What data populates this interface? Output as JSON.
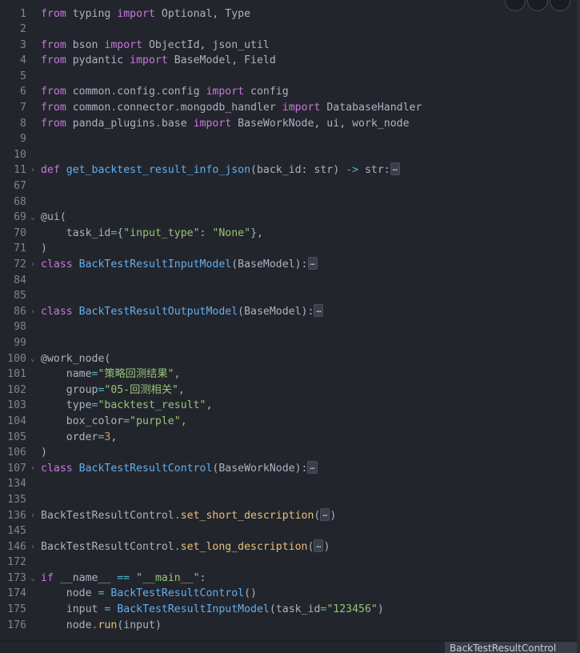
{
  "statusbar": {
    "breadcrumb": "BackTestResultControl"
  },
  "fold_placeholder": "…",
  "lines": [
    {
      "n": "1",
      "fold": "",
      "tokens": [
        [
          "kw",
          "from"
        ],
        [
          "pl",
          " typing "
        ],
        [
          "kw",
          "import"
        ],
        [
          "pl",
          " Optional, Type"
        ]
      ]
    },
    {
      "n": "2",
      "fold": "",
      "tokens": []
    },
    {
      "n": "3",
      "fold": "",
      "tokens": [
        [
          "kw",
          "from"
        ],
        [
          "pl",
          " bson "
        ],
        [
          "kw",
          "import"
        ],
        [
          "pl",
          " ObjectId, json_util"
        ]
      ]
    },
    {
      "n": "4",
      "fold": "",
      "tokens": [
        [
          "kw",
          "from"
        ],
        [
          "pl",
          " pydantic "
        ],
        [
          "kw",
          "import"
        ],
        [
          "pl",
          " BaseModel, Field"
        ]
      ]
    },
    {
      "n": "5",
      "fold": "",
      "tokens": []
    },
    {
      "n": "6",
      "fold": "",
      "tokens": [
        [
          "kw",
          "from"
        ],
        [
          "pl",
          " common"
        ],
        [
          "op",
          "."
        ],
        [
          "pl",
          "config"
        ],
        [
          "op",
          "."
        ],
        [
          "pl",
          "config "
        ],
        [
          "kw",
          "import"
        ],
        [
          "pl",
          " config"
        ]
      ]
    },
    {
      "n": "7",
      "fold": "",
      "tokens": [
        [
          "kw",
          "from"
        ],
        [
          "pl",
          " common"
        ],
        [
          "op",
          "."
        ],
        [
          "pl",
          "connector"
        ],
        [
          "op",
          "."
        ],
        [
          "pl",
          "mongodb_handler "
        ],
        [
          "kw",
          "import"
        ],
        [
          "pl",
          " DatabaseHandler"
        ]
      ]
    },
    {
      "n": "8",
      "fold": "",
      "tokens": [
        [
          "kw",
          "from"
        ],
        [
          "pl",
          " panda_plugins"
        ],
        [
          "op",
          "."
        ],
        [
          "pl",
          "base "
        ],
        [
          "kw",
          "import"
        ],
        [
          "pl",
          " BaseWorkNode, ui, work_node"
        ]
      ]
    },
    {
      "n": "9",
      "fold": "",
      "tokens": []
    },
    {
      "n": "10",
      "fold": "",
      "tokens": []
    },
    {
      "n": "11",
      "fold": ">",
      "tokens": [
        [
          "kw",
          "def"
        ],
        [
          "pl",
          " "
        ],
        [
          "fn",
          "get_backtest_result_info_json"
        ],
        [
          "pl",
          "(back_id: str) "
        ],
        [
          "op",
          "->"
        ],
        [
          "pl",
          " str:"
        ],
        [
          "ell",
          ""
        ]
      ]
    },
    {
      "n": "67",
      "fold": "",
      "tokens": []
    },
    {
      "n": "68",
      "fold": "",
      "tokens": []
    },
    {
      "n": "69",
      "fold": "v",
      "tokens": [
        [
          "dec",
          "@ui("
        ]
      ]
    },
    {
      "n": "70",
      "fold": "",
      "tokens": [
        [
          "pl",
          "    task_id"
        ],
        [
          "op",
          "="
        ],
        [
          "pl",
          "{"
        ],
        [
          "str",
          "\"input_type\""
        ],
        [
          "pl",
          ": "
        ],
        [
          "str",
          "\"None\""
        ],
        [
          "pl",
          "},"
        ]
      ]
    },
    {
      "n": "71",
      "fold": "",
      "tokens": [
        [
          "pl",
          ")"
        ]
      ]
    },
    {
      "n": "72",
      "fold": ">",
      "tokens": [
        [
          "kw",
          "class"
        ],
        [
          "pl",
          " "
        ],
        [
          "cls",
          "BackTestResultInputModel"
        ],
        [
          "pl",
          "(BaseModel):"
        ],
        [
          "ell",
          ""
        ]
      ]
    },
    {
      "n": "84",
      "fold": "",
      "tokens": []
    },
    {
      "n": "85",
      "fold": "",
      "tokens": []
    },
    {
      "n": "86",
      "fold": ">",
      "tokens": [
        [
          "kw",
          "class"
        ],
        [
          "pl",
          " "
        ],
        [
          "cls",
          "BackTestResultOutputModel"
        ],
        [
          "pl",
          "(BaseModel):"
        ],
        [
          "ell",
          ""
        ]
      ]
    },
    {
      "n": "98",
      "fold": "",
      "tokens": []
    },
    {
      "n": "99",
      "fold": "",
      "tokens": []
    },
    {
      "n": "100",
      "fold": "v",
      "tokens": [
        [
          "dec",
          "@work_node("
        ]
      ]
    },
    {
      "n": "101",
      "fold": "",
      "tokens": [
        [
          "pl",
          "    name"
        ],
        [
          "op",
          "="
        ],
        [
          "str",
          "\"策略回测结果\""
        ],
        [
          "pl",
          ","
        ]
      ]
    },
    {
      "n": "102",
      "fold": "",
      "tokens": [
        [
          "pl",
          "    group"
        ],
        [
          "op",
          "="
        ],
        [
          "str",
          "\"05-回测相关\""
        ],
        [
          "pl",
          ","
        ]
      ]
    },
    {
      "n": "103",
      "fold": "",
      "tokens": [
        [
          "pl",
          "    type"
        ],
        [
          "op",
          "="
        ],
        [
          "str",
          "\"backtest_result\""
        ],
        [
          "pl",
          ","
        ]
      ]
    },
    {
      "n": "104",
      "fold": "",
      "tokens": [
        [
          "pl",
          "    box_color"
        ],
        [
          "op",
          "="
        ],
        [
          "str",
          "\"purple\""
        ],
        [
          "pl",
          ","
        ]
      ]
    },
    {
      "n": "105",
      "fold": "",
      "tokens": [
        [
          "pl",
          "    order"
        ],
        [
          "op",
          "="
        ],
        [
          "num",
          "3"
        ],
        [
          "pl",
          ","
        ]
      ]
    },
    {
      "n": "106",
      "fold": "",
      "tokens": [
        [
          "pl",
          ")"
        ]
      ]
    },
    {
      "n": "107",
      "fold": ">",
      "tokens": [
        [
          "kw",
          "class"
        ],
        [
          "pl",
          " "
        ],
        [
          "cls",
          "BackTestResultControl"
        ],
        [
          "pl",
          "(BaseWorkNode):"
        ],
        [
          "ell",
          ""
        ]
      ]
    },
    {
      "n": "134",
      "fold": "",
      "tokens": []
    },
    {
      "n": "135",
      "fold": "",
      "tokens": []
    },
    {
      "n": "136",
      "fold": ">",
      "tokens": [
        [
          "pl",
          "BackTestResultControl"
        ],
        [
          "op",
          "."
        ],
        [
          "mt",
          "set_short_description"
        ],
        [
          "pl",
          "("
        ],
        [
          "ell",
          ""
        ],
        [
          "pl",
          ")"
        ]
      ]
    },
    {
      "n": "145",
      "fold": "",
      "tokens": []
    },
    {
      "n": "146",
      "fold": ">",
      "tokens": [
        [
          "pl",
          "BackTestResultControl"
        ],
        [
          "op",
          "."
        ],
        [
          "mt",
          "set_long_description"
        ],
        [
          "pl",
          "("
        ],
        [
          "ell",
          ""
        ],
        [
          "pl",
          ")"
        ]
      ]
    },
    {
      "n": "172",
      "fold": "",
      "tokens": []
    },
    {
      "n": "173",
      "fold": "v",
      "tokens": [
        [
          "kw",
          "if"
        ],
        [
          "pl",
          " __name__ "
        ],
        [
          "op",
          "=="
        ],
        [
          "pl",
          " "
        ],
        [
          "str",
          "\"__main__\""
        ],
        [
          "pl",
          ":"
        ]
      ]
    },
    {
      "n": "174",
      "fold": "",
      "tokens": [
        [
          "pl",
          "    node "
        ],
        [
          "op",
          "="
        ],
        [
          "pl",
          " "
        ],
        [
          "cls",
          "BackTestResultControl"
        ],
        [
          "pl",
          "()"
        ]
      ]
    },
    {
      "n": "175",
      "fold": "",
      "tokens": [
        [
          "pl",
          "    input "
        ],
        [
          "op",
          "="
        ],
        [
          "pl",
          " "
        ],
        [
          "cls",
          "BackTestResultInputModel"
        ],
        [
          "pl",
          "(task_id"
        ],
        [
          "op",
          "="
        ],
        [
          "str",
          "\"123456\""
        ],
        [
          "pl",
          ")"
        ]
      ]
    },
    {
      "n": "176",
      "fold": "",
      "tokens": [
        [
          "pl",
          "    node"
        ],
        [
          "op",
          "."
        ],
        [
          "mt",
          "run"
        ],
        [
          "pl",
          "(input)"
        ]
      ]
    }
  ]
}
